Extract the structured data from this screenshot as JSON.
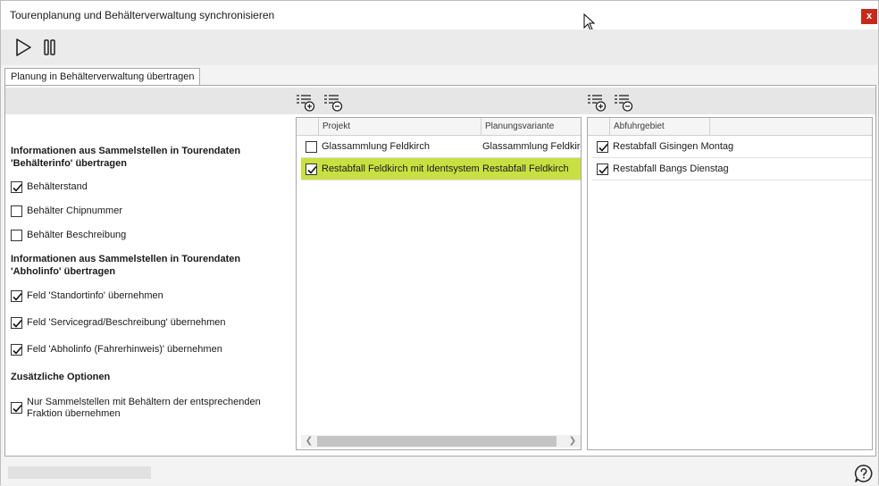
{
  "window": {
    "title": "Tourenplanung und Behälterverwaltung synchronisieren",
    "close_label": "x"
  },
  "toolbar": {
    "icons": [
      "play-icon",
      "pause-icon"
    ]
  },
  "tabs": [
    {
      "label": "Planung in Behälterverwaltung übertragen",
      "active": true
    }
  ],
  "options": {
    "section1_title": "Informationen aus Sammelstellen in Tourendaten 'Behälterinfo' übertragen",
    "section1_items": [
      {
        "label": "Behälterstand",
        "checked": true
      },
      {
        "label": "Behälter Chipnummer",
        "checked": false
      },
      {
        "label": "Behälter Beschreibung",
        "checked": false
      }
    ],
    "section2_title": "Informationen aus Sammelstellen in Tourendaten 'Abholinfo' übertragen",
    "section2_items": [
      {
        "label": "Feld 'Standortinfo' übernehmen",
        "checked": true
      },
      {
        "label": "Feld 'Servicegrad/Beschreibung' übernehmen",
        "checked": true
      },
      {
        "label": "Feld 'Abholinfo (Fahrerhinweis)' übernehmen",
        "checked": true
      }
    ],
    "section3_title": "Zusätzliche Optionen",
    "section3_items": [
      {
        "label": "Nur Sammelstellen mit Behältern der entsprechenden Fraktion übernehmen",
        "checked": true
      }
    ]
  },
  "projects_grid": {
    "columns": [
      "Projekt",
      "Planungsvariante"
    ],
    "rows": [
      {
        "checked": false,
        "selected": false,
        "projekt": "Glassammlung Feldkirch",
        "variante": "Glassammlung Feldkirch"
      },
      {
        "checked": true,
        "selected": true,
        "projekt": "Restabfall Feldkirch mit Identsystem",
        "variante": "Restabfall Feldkirch"
      }
    ]
  },
  "areas_grid": {
    "columns": [
      "Abfuhrgebiet"
    ],
    "rows": [
      {
        "checked": true,
        "label": "Restabfall Gisingen Montag"
      },
      {
        "checked": true,
        "label": "Restabfall Bangs Dienstag"
      }
    ]
  },
  "colors": {
    "selection": "#c9e043",
    "close": "#c42b1c"
  }
}
